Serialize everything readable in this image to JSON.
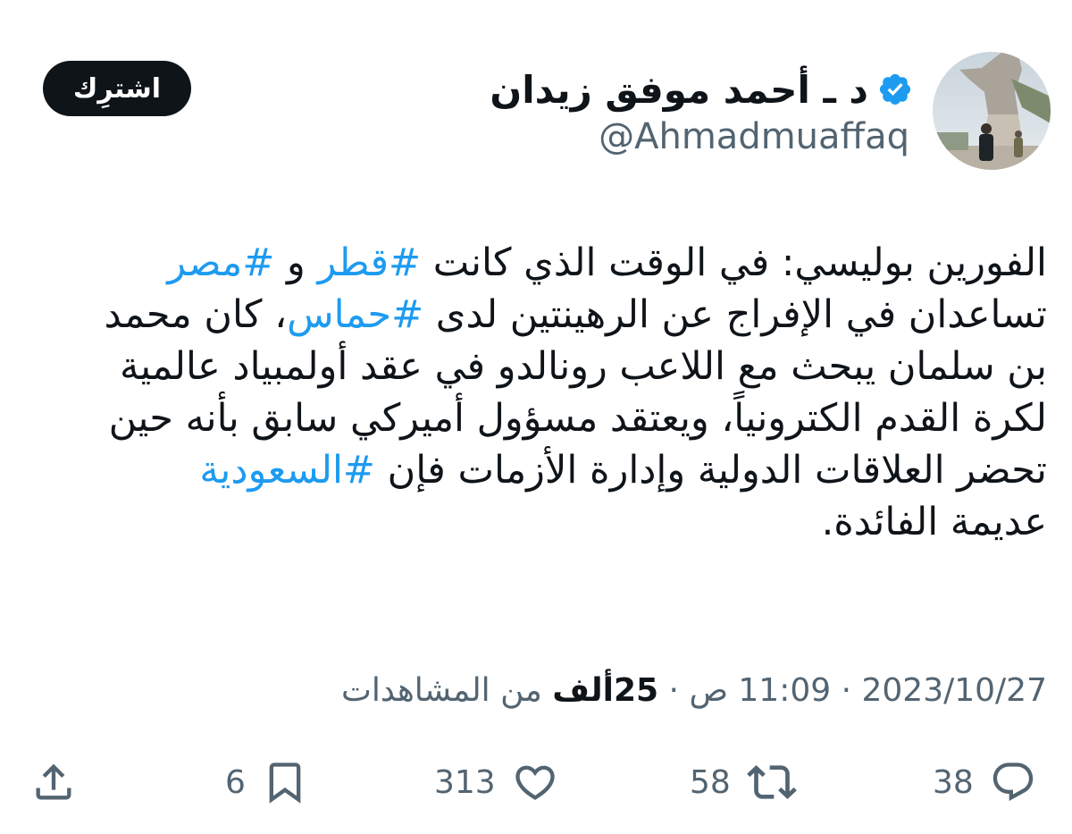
{
  "author": {
    "display_name": "د ـ أحمد موفق زيدان",
    "handle": "@Ahmadmuaffaq",
    "verified_icon": "verified-badge-icon",
    "avatar_icon": "avatar-photo"
  },
  "header": {
    "subscribe_label": "اشترِك"
  },
  "tweet": {
    "lines": [
      {
        "pre": "الفورين بوليسي: في الوقت الذي كانت ",
        "tag1": "#قطر",
        "mid": " و ",
        "tag2": "#مصر",
        "post": ""
      },
      {
        "pre": "تساعدان في الإفراج عن الرهينتين لدى ",
        "tag1": "#حماس",
        "post": "، كان محمد"
      },
      {
        "text": "بن سلمان يبحث مع اللاعب رونالدو في عقد أولمبياد عالمية"
      },
      {
        "text": "لكرة القدم الكترونياً، ويعتقد مسؤول أميركي سابق بأنه حين"
      },
      {
        "pre": "تحضر العلاقات الدولية وإدارة الأزمات فإن ",
        "tag1": "#السعودية",
        "post": ""
      },
      {
        "text": "عديمة الفائدة."
      }
    ]
  },
  "meta": {
    "date": "2023/10/27",
    "separator": " · ",
    "time": "11:09 ص",
    "views_count": "25ألف",
    "views_label": " من المشاهدات"
  },
  "actions": {
    "replies": "38",
    "retweets": "58",
    "likes": "313",
    "bookmarks": "6"
  },
  "colors": {
    "accent": "#1d9bf0",
    "text": "#0f1419",
    "muted": "#536471",
    "button_bg": "#0f1419"
  }
}
